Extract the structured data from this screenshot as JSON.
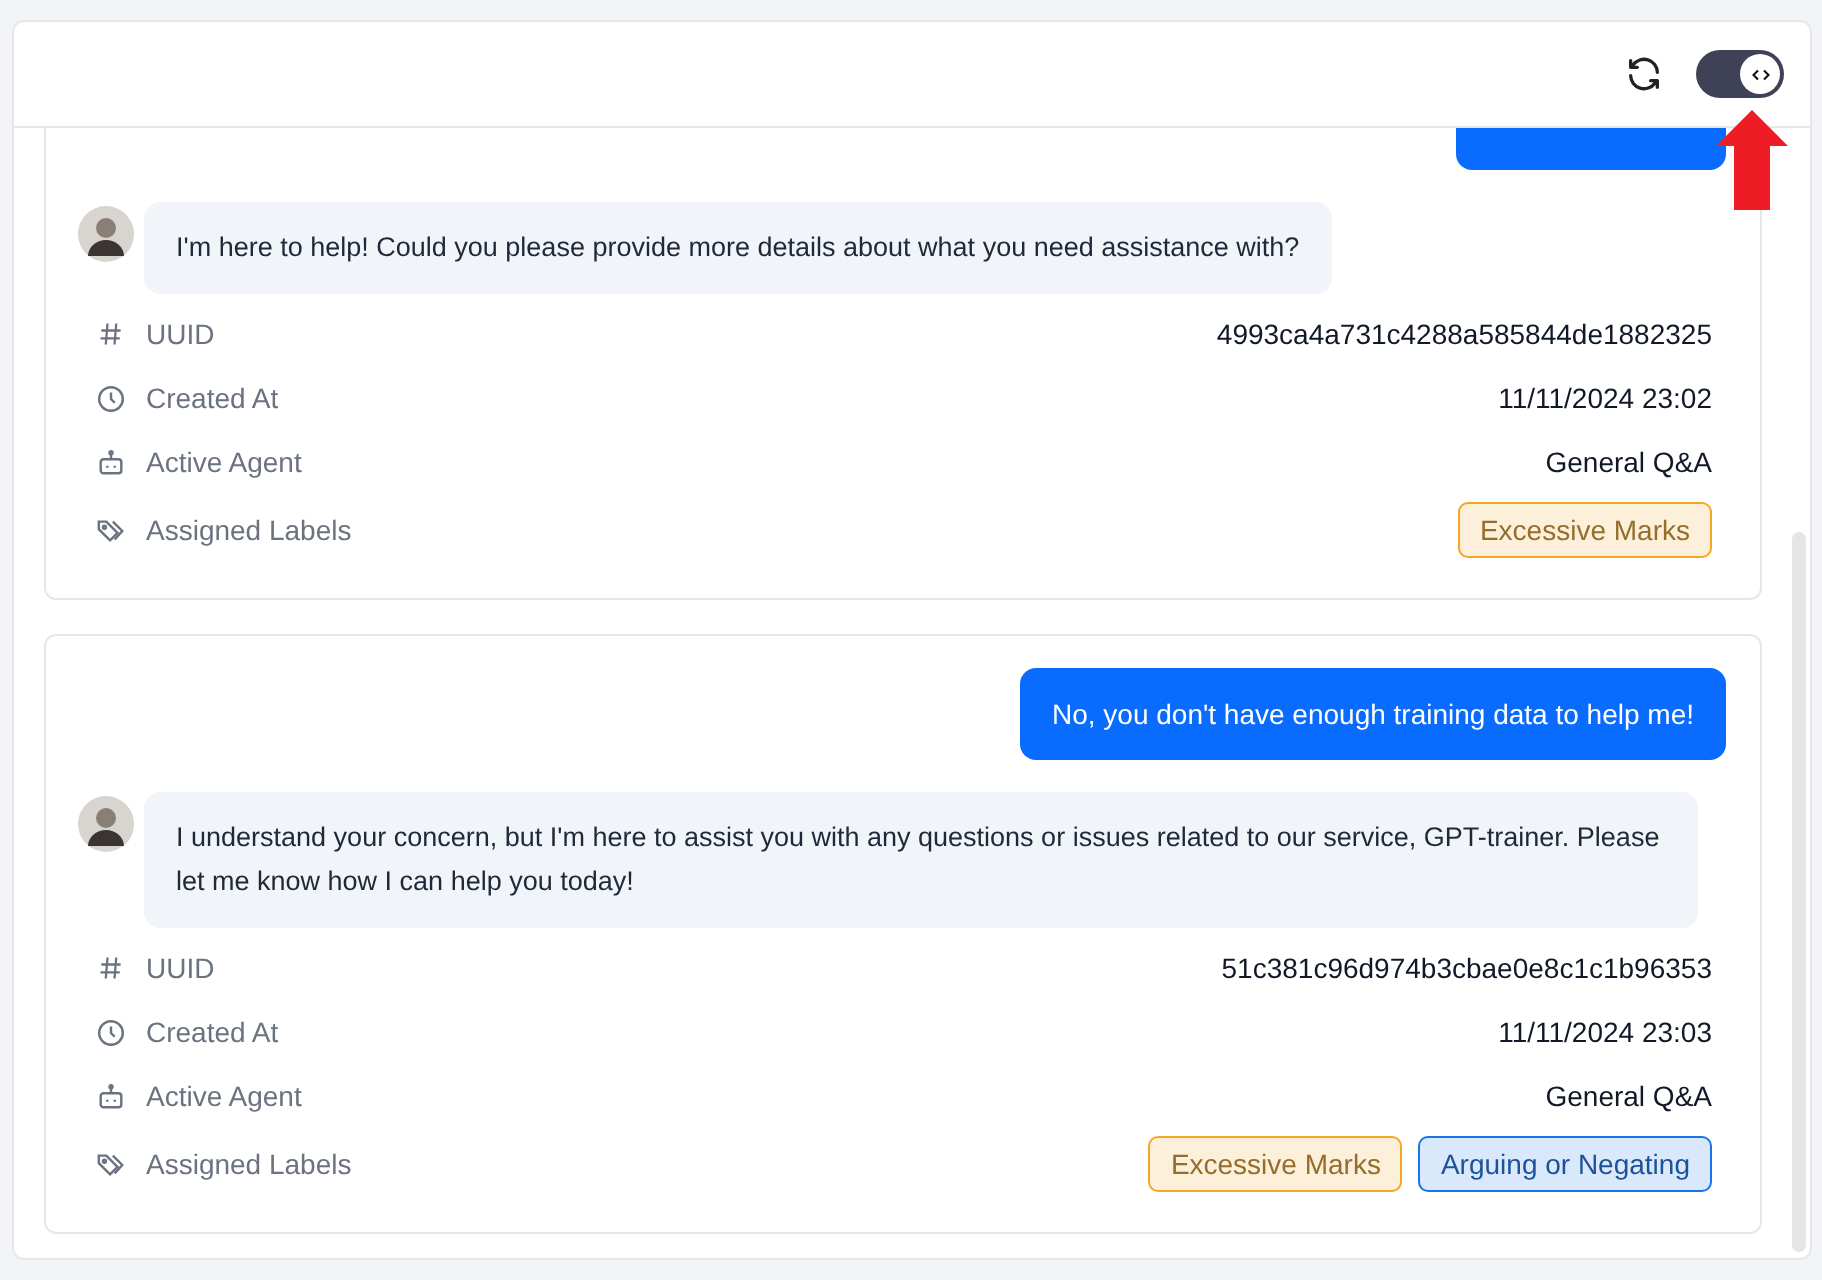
{
  "header": {
    "toggle": {
      "on": true
    }
  },
  "conversations": [
    {
      "cut_off_top": true,
      "messages": [
        {
          "kind": "assistant",
          "text": "I'm here to help! Could you please provide more details about what you need assistance with?"
        }
      ],
      "details": [
        {
          "kind": "uuid",
          "label": "UUID",
          "value": "4993ca4a731c4288a585844de1882325"
        },
        {
          "kind": "created",
          "label": "Created At",
          "value": "11/11/2024 23:02"
        },
        {
          "kind": "agent",
          "label": "Active Agent",
          "value": "General Q&A"
        }
      ],
      "labels_row": {
        "label": "Assigned Labels",
        "labels": [
          {
            "text": "Excessive Marks",
            "color": "#f5a623"
          }
        ]
      }
    },
    {
      "cut_off_top": false,
      "messages": [
        {
          "kind": "user",
          "text": "No, you don't have enough training data to help me!"
        },
        {
          "kind": "assistant",
          "text": "I understand your concern, but I'm here to assist you with any questions or issues related to our service, GPT-trainer. Please let me know how I can help you today!"
        }
      ],
      "details": [
        {
          "kind": "uuid",
          "label": "UUID",
          "value": "51c381c96d974b3cbae0e8c1c1b96353"
        },
        {
          "kind": "created",
          "label": "Created At",
          "value": "11/11/2024 23:03"
        },
        {
          "kind": "agent",
          "label": "Active Agent",
          "value": "General Q&A"
        }
      ],
      "labels_row": {
        "label": "Assigned Labels",
        "labels": [
          {
            "text": "Excessive Marks",
            "color": "#f5a623"
          },
          {
            "text": "Arguing or Negating",
            "color": "#1a73e8"
          }
        ]
      }
    }
  ]
}
